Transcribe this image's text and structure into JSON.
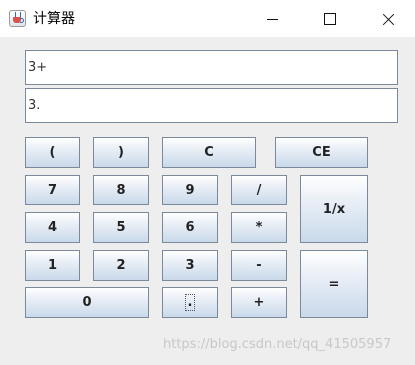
{
  "window": {
    "title": "计算器",
    "controls": {
      "minimize": "minimize",
      "maximize": "maximize",
      "close": "close"
    }
  },
  "display": {
    "expression": "3+",
    "result": "3."
  },
  "buttons": {
    "lparen": "(",
    "rparen": ")",
    "clear": "C",
    "clear_entry": "CE",
    "seven": "7",
    "eight": "8",
    "nine": "9",
    "divide": "/",
    "reciprocal": "1/x",
    "four": "4",
    "five": "5",
    "six": "6",
    "multiply": "*",
    "one": "1",
    "two": "2",
    "three": "3",
    "minus": "-",
    "equals": "=",
    "zero": "0",
    "decimal": ".",
    "plus": "+"
  },
  "watermark": "https://blog.csdn.net/qq_41505957"
}
